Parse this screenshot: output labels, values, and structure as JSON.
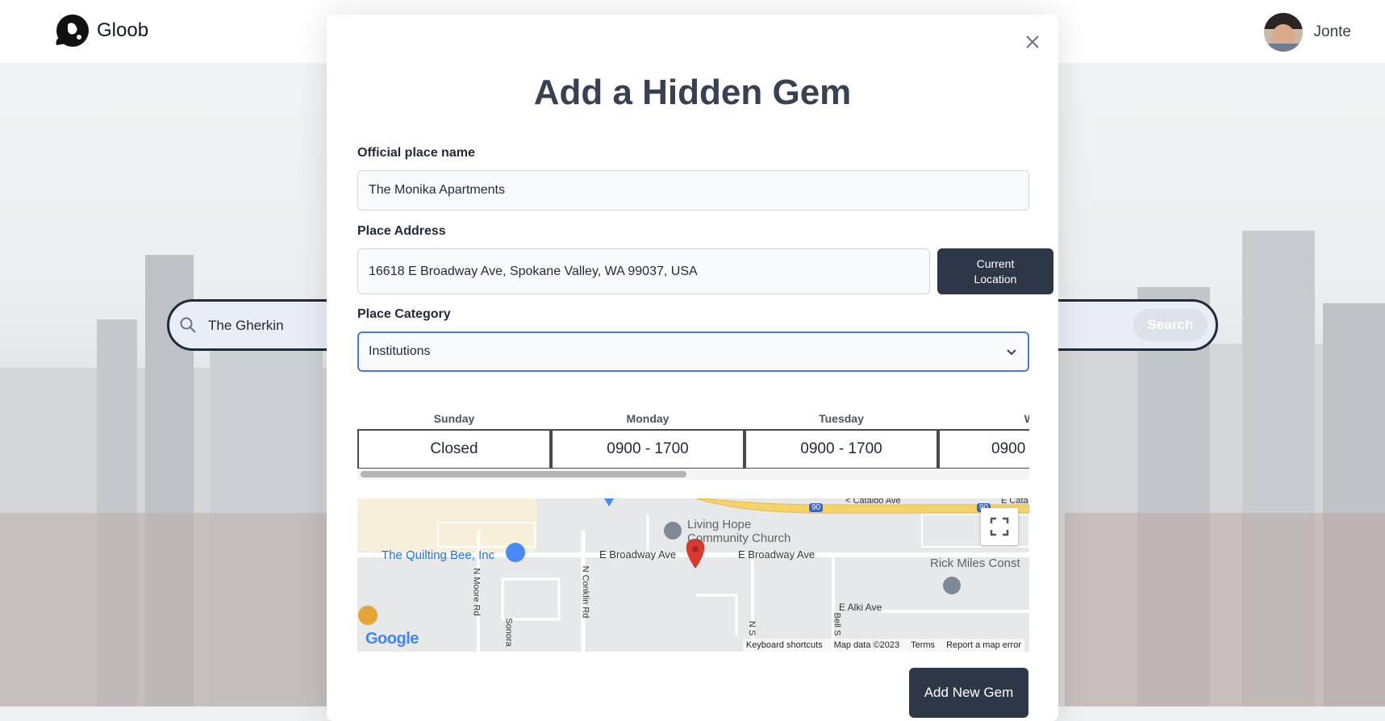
{
  "app": {
    "name": "Gloob"
  },
  "user": {
    "name": "Jonte"
  },
  "search": {
    "value": "The Gherkin",
    "button_label": "Search"
  },
  "modal": {
    "title": "Add a Hidden Gem",
    "place_name": {
      "label": "Official place name",
      "value": "The Monika Apartments"
    },
    "address": {
      "label": "Place Address",
      "value": "16618 E Broadway Ave, Spokane Valley, WA 99037, USA",
      "current_location_label": "Current Location"
    },
    "category": {
      "label": "Place Category",
      "selected": "Institutions"
    },
    "hours": [
      {
        "day": "Sunday",
        "value": "Closed"
      },
      {
        "day": "Monday",
        "value": "0900 - 1700"
      },
      {
        "day": "Tuesday",
        "value": "0900 - 1700"
      },
      {
        "day": "Wedi",
        "value": "0900"
      }
    ],
    "map": {
      "labels": {
        "church_1": "Living Hope",
        "church_2": "Community Church",
        "quilting": "The Quilting Bee, Inc",
        "broadway_1": "E Broadway Ave",
        "broadway_2": "E Broadway Ave",
        "rick": "Rick Miles Const",
        "alki": "E Alki Ave",
        "cataldo": "< Cataldo Ave",
        "cataldo_2": "E Cata",
        "moore": "N Moore Rd",
        "conklin": "N Conklin Rd",
        "sonora": "Sonora",
        "ns": "N S",
        "bell": "Bell S",
        "hwy": "90",
        "hwy_2": "90"
      },
      "google": "Google",
      "attribution": [
        "Keyboard shortcuts",
        "Map data ©2023",
        "Terms",
        "Report a map error"
      ]
    },
    "submit_label": "Add New Gem"
  },
  "colors": {
    "primary_button": "#2d3748",
    "focus_border": "#4f79c8",
    "map_pin": "#d93a2f"
  }
}
